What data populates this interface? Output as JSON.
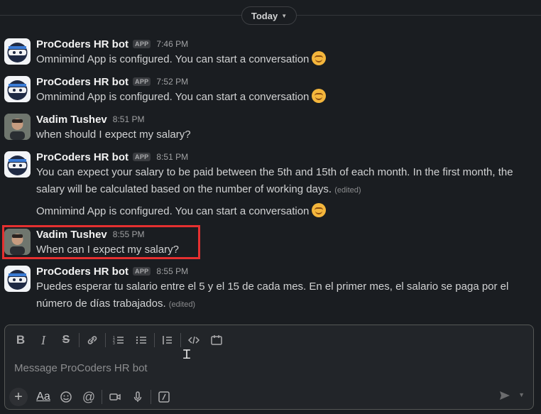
{
  "divider": {
    "label": "Today"
  },
  "messages": [
    {
      "sender": "ProCoders HR bot",
      "badge": "APP",
      "time": "7:46 PM",
      "lines": [
        "Omnimind App is configured. You can start a conversation"
      ]
    },
    {
      "sender": "ProCoders HR bot",
      "badge": "APP",
      "time": "7:52 PM",
      "lines": [
        "Omnimind App is configured. You can start a conversation"
      ]
    },
    {
      "sender": "Vadim Tushev",
      "time": "8:51 PM",
      "lines": [
        "when should I expect my salary?"
      ]
    },
    {
      "sender": "ProCoders HR bot",
      "badge": "APP",
      "time": "8:51 PM",
      "lines": [
        "You can expect your salary to be paid between the 5th and 15th of each month. In the first month, the",
        "salary will be calculated based on the number of working days."
      ],
      "edited": "(edited)",
      "followup": "Omnimind App is configured. You can start a conversation"
    },
    {
      "sender": "Vadim Tushev",
      "time": "8:55 PM",
      "lines": [
        "When can I expect my salary?"
      ]
    },
    {
      "sender": "ProCoders HR bot",
      "badge": "APP",
      "time": "8:55 PM",
      "lines": [
        "Puedes esperar tu salario entre el 5 y el 15 de cada mes. En el primer mes, el salario se paga por el",
        "número de días trabajados."
      ],
      "edited": "(edited)"
    }
  ],
  "composer": {
    "placeholder": "Message ProCoders HR bot",
    "format_buttons": [
      "B",
      "I",
      "S"
    ],
    "aa_label": "Aa"
  },
  "icons": {
    "emoji": "sleepy-face-icon",
    "send": "send-icon"
  },
  "colors": {
    "background": "#1a1d21",
    "highlight": "#e53030"
  }
}
